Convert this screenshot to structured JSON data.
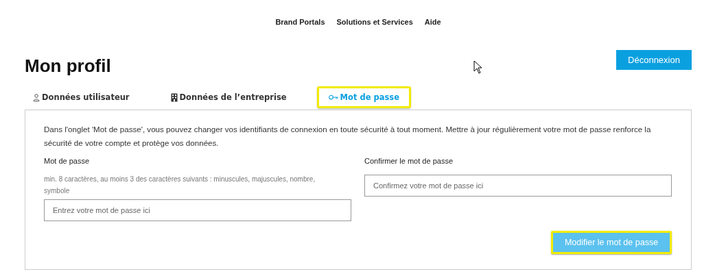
{
  "nav": [
    "Brand Portals",
    "Solutions et Services",
    "Aide"
  ],
  "title": "Mon profil",
  "logout_button": "Déconnexion",
  "tabs": [
    {
      "label": "Données utilisateur",
      "selected": false,
      "highlighted": false
    },
    {
      "label": "Données de l’entreprise",
      "selected": false,
      "highlighted": false
    },
    {
      "label": "Mot de passe",
      "selected": true,
      "highlighted": true
    }
  ],
  "intro": "Dans l'onglet 'Mot de passe', vous pouvez changer vos identifiants de connexion en toute sécurité à tout moment. Mettre à jour régulièrement votre mot de passe renforce la sécurité de votre compte et protège vos données.",
  "password": {
    "label": "Mot de passe",
    "hint": "min. 8 caractères, au moins 3 des caractères suivants : minuscules, majuscules, nombre, symbole",
    "placeholder": "Entrez votre mot de passe ici"
  },
  "confirm": {
    "label": "Confirmer le mot de passe",
    "placeholder": "Confirmez votre mot de passe ici"
  },
  "submit_button": {
    "label": "Modifier le mot de passe",
    "highlighted": true
  }
}
